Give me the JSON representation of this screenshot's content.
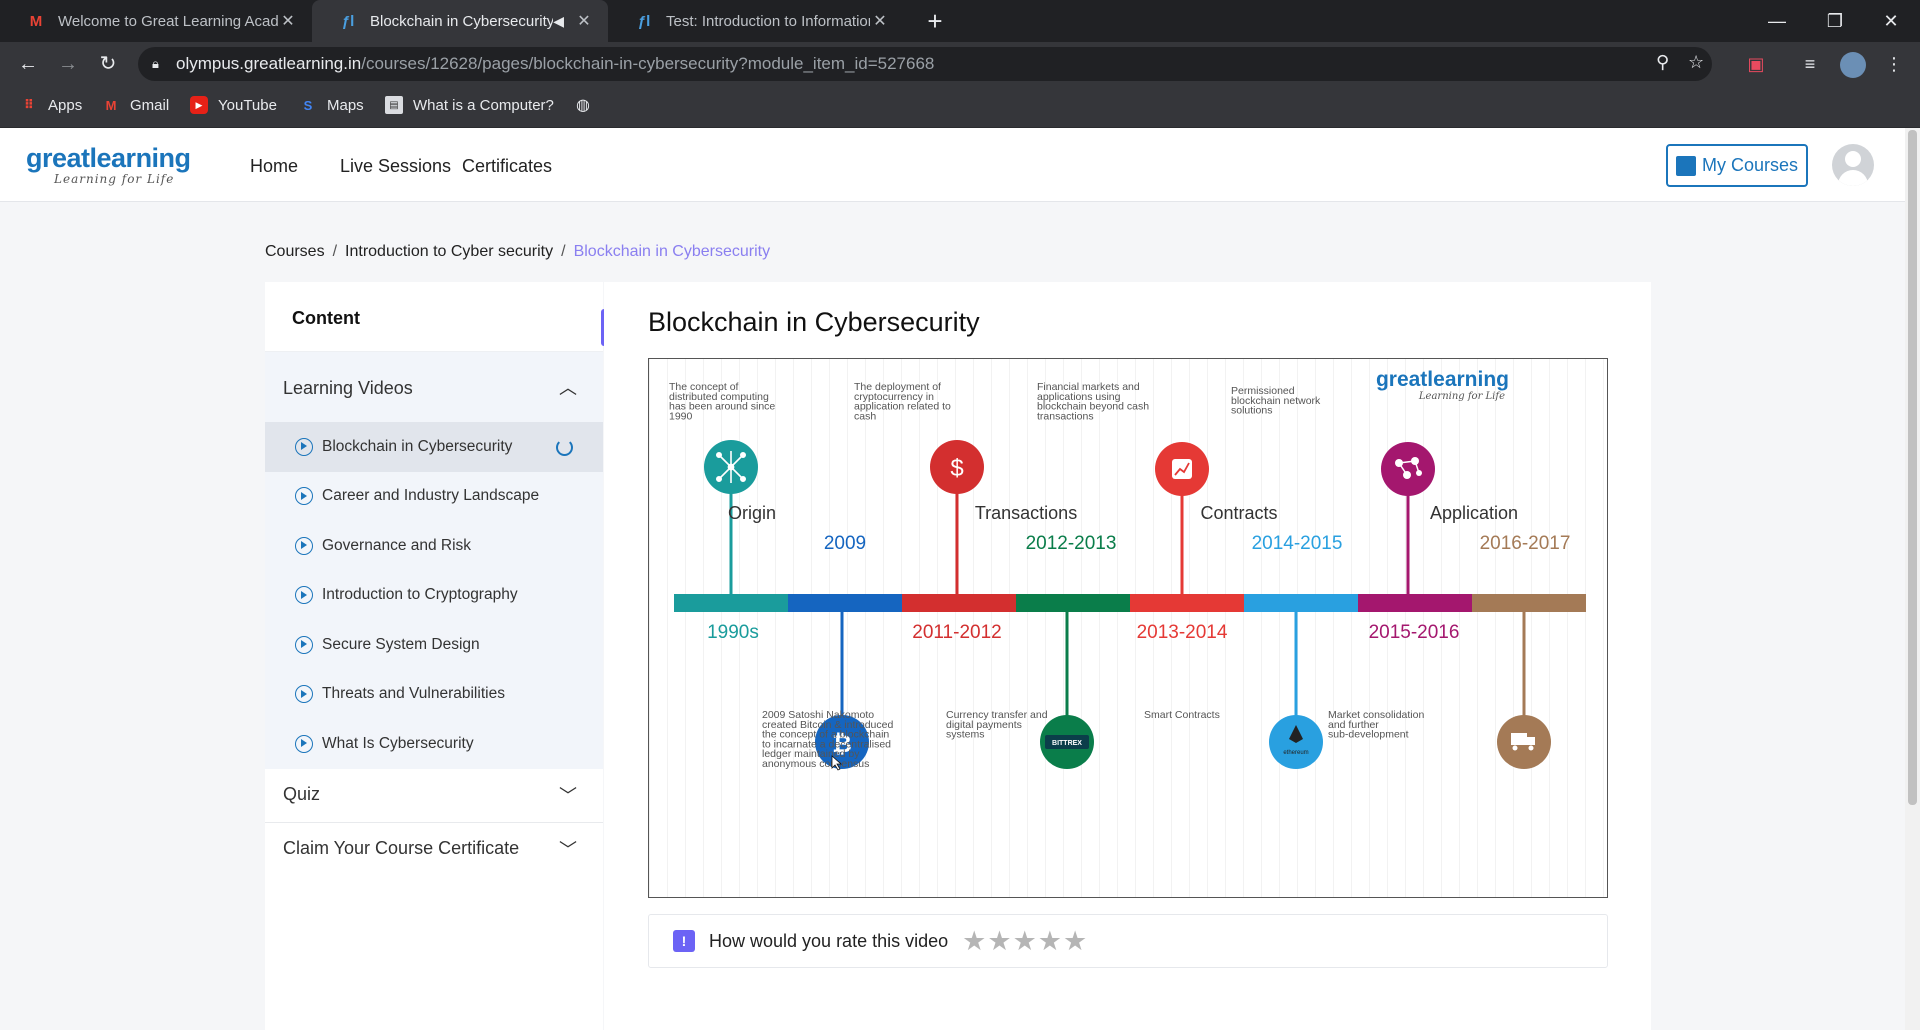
{
  "browser": {
    "tabs": [
      {
        "title": "Welcome to Great Learning Acad",
        "favicon": "gmail-icon",
        "active": false
      },
      {
        "title": "Blockchain in Cybersecurity: |",
        "favicon": "greatlearning-icon",
        "active": true
      },
      {
        "title": "Test: Introduction to Information",
        "favicon": "greatlearning-icon",
        "active": false
      }
    ],
    "url_host": "olympus.greatlearning.in",
    "url_path": "/courses/12628/pages/blockchain-in-cybersecurity?module_item_id=527668",
    "bookmarks": [
      {
        "label": "Apps",
        "icon": "apps-grid-icon"
      },
      {
        "label": "Gmail",
        "icon": "gmail-icon"
      },
      {
        "label": "YouTube",
        "icon": "youtube-icon"
      },
      {
        "label": "Maps",
        "icon": "maps-icon"
      },
      {
        "label": "What is a Computer?",
        "icon": "bookmark-page-icon"
      },
      {
        "label": "",
        "icon": "globe-icon"
      }
    ]
  },
  "site": {
    "logo_main": "greatlearning",
    "logo_sub": "Learning for Life",
    "nav": [
      "Home",
      "Live Sessions",
      "Certificates"
    ],
    "my_courses": "My Courses",
    "brand_color": "#1b75bb",
    "accent_color": "#6c63f5"
  },
  "breadcrumb": [
    "Courses",
    "Introduction to Cyber security",
    "Blockchain in Cybersecurity"
  ],
  "sidebar": {
    "header": "Content",
    "learning_videos": "Learning Videos",
    "items": [
      "Blockchain in Cybersecurity",
      "Career and Industry Landscape",
      "Governance and Risk",
      "Introduction to Cryptography",
      "Secure System Design",
      "Threats and Vulnerabilities",
      "What Is Cybersecurity"
    ],
    "quiz": "Quiz",
    "certificate": "Claim Your Course Certificate"
  },
  "content": {
    "title": "Blockchain in Cybersecurity",
    "rating_prompt": "How would you rate this video",
    "rating_stars": 5
  },
  "figure": {
    "logo_main": "greatlearning",
    "logo_sub": "Learning for Life",
    "stages": [
      "Origin",
      "Transactions",
      "Contracts",
      "Application"
    ],
    "top_years": [
      "2009",
      "2012-2013",
      "2014-2015",
      "2016-2017"
    ],
    "bottom_years": [
      "1990s",
      "2011-2012",
      "2013-2014",
      "2015-2016"
    ],
    "top_descriptions": [
      [
        "The concept of",
        "distributed computing",
        "has been around since",
        "1990"
      ],
      [
        "The deployment of",
        "cryptocurrency in",
        "application related to",
        "cash"
      ],
      [
        "Financial markets and",
        "applications using",
        "blockchain beyond cash",
        "transactions"
      ],
      [
        "Permissioned",
        "blockchain network",
        "solutions"
      ]
    ],
    "bottom_descriptions": [
      [
        "2009 Satoshi Nakomoto",
        "created Bitcoin  & introduced",
        "the concept of a blockchain",
        "to incarnate a decentralised",
        "ledger  maintained by",
        "anonymous consensus"
      ],
      [
        "Currency transfer and",
        "digital payments",
        "systems"
      ],
      [
        "Smart Contracts"
      ],
      [
        "Market consolidation",
        "and further",
        "sub-development"
      ]
    ],
    "icon_labels": [
      "₿",
      "BITTREX",
      "ethereum"
    ],
    "colors": [
      "#1a9c9c",
      "#1565c0",
      "#d32f2f",
      "#0a7d4a",
      "#e53935",
      "#29a0e0",
      "#a4176e",
      "#a47a56"
    ]
  }
}
